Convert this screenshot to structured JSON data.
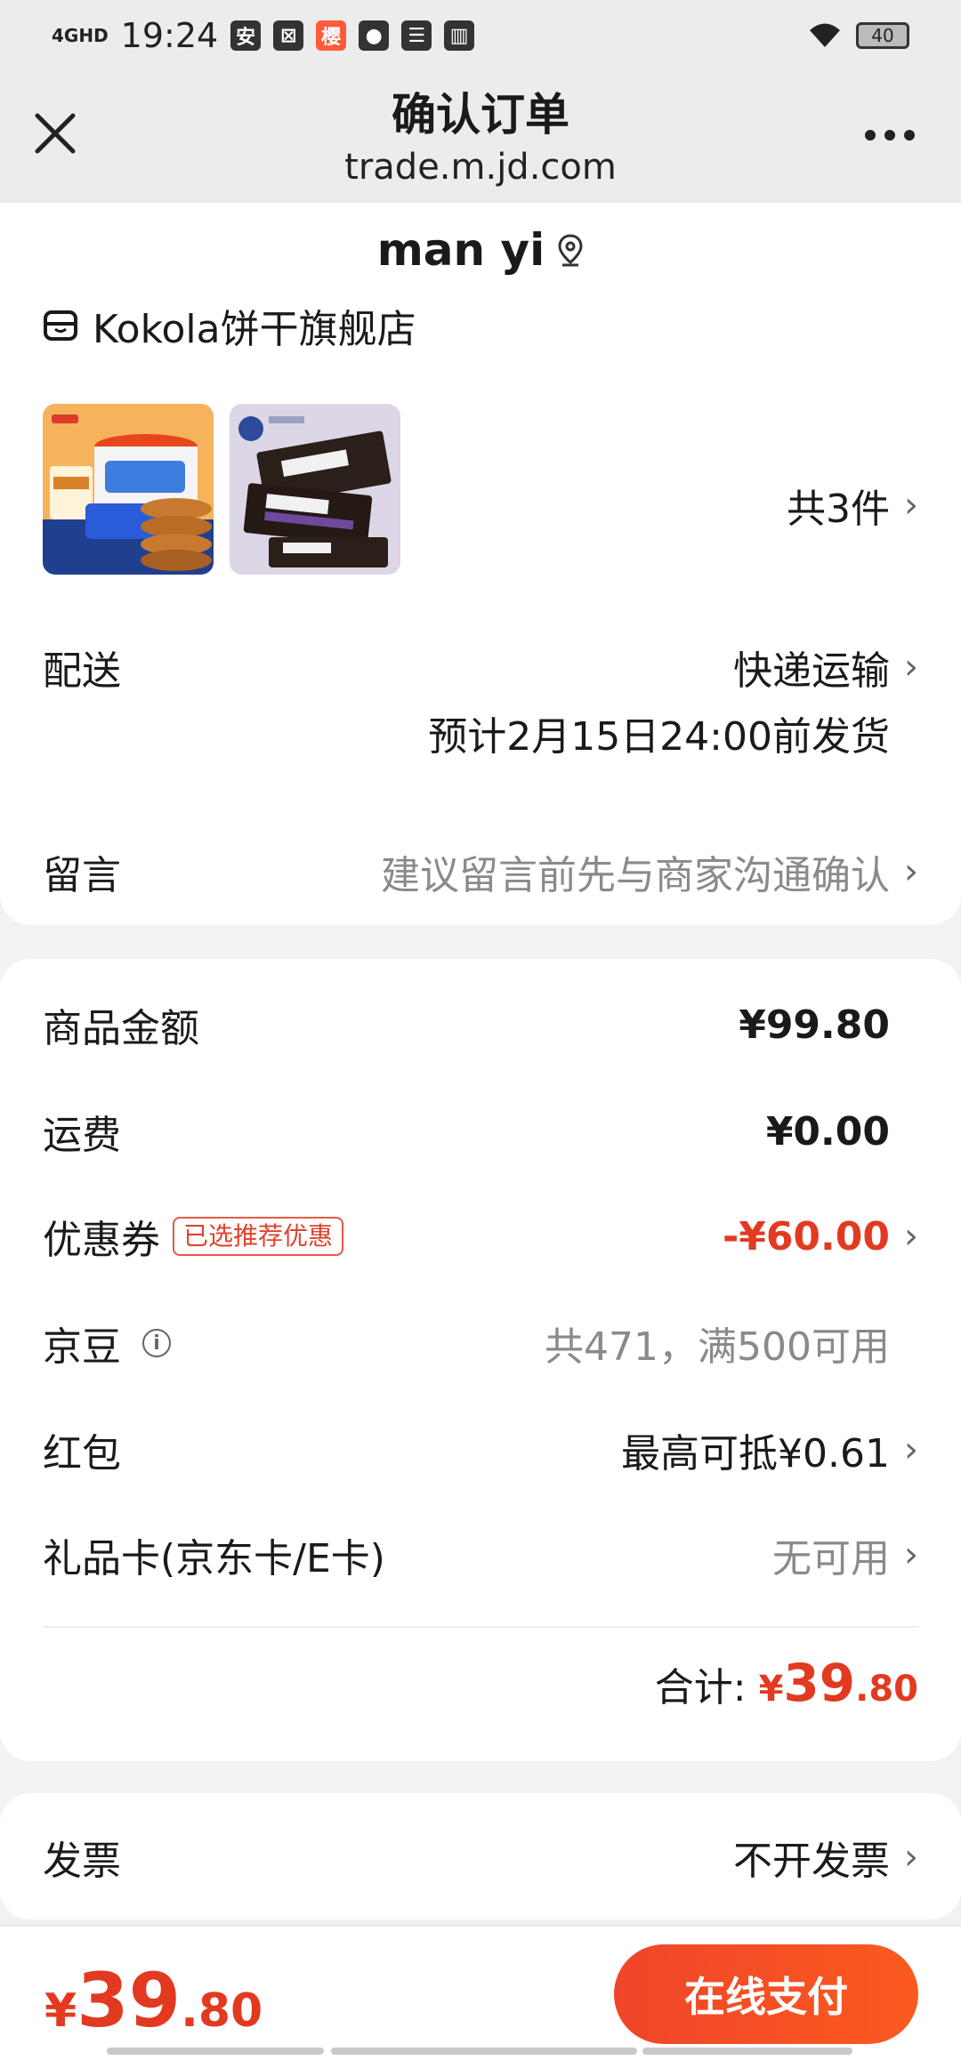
{
  "status_bar": {
    "time": "19:24",
    "network": "4GHD",
    "app_icons": [
      "安",
      "⊠",
      "樱",
      "●",
      "☰",
      "▥"
    ],
    "battery": "40"
  },
  "title_bar": {
    "title": "确认订单",
    "url": "trade.m.jd.com"
  },
  "address": {
    "name": "man yi"
  },
  "store": {
    "name": "Kokola饼干旗舰店",
    "item_count": "共3件"
  },
  "delivery": {
    "label": "配送",
    "method": "快递运输",
    "estimate": "预计2月15日24:00前发货"
  },
  "note": {
    "label": "留言",
    "placeholder": "建议留言前先与商家沟通确认"
  },
  "summary": {
    "goods_label": "商品金额",
    "goods_value": "¥99.80",
    "shipping_label": "运费",
    "shipping_value": "¥0.00",
    "coupon_label": "优惠券",
    "coupon_badge": "已选推荐优惠",
    "coupon_value": "-¥60.00",
    "beans_label": "京豆",
    "beans_value": "共471，满500可用",
    "redpack_label": "红包",
    "redpack_value": "最高可抵¥0.61",
    "giftcard_label": "礼品卡(京东卡/E卡)",
    "giftcard_value": "无可用",
    "total_label": "合计:",
    "total_yen": "¥",
    "total_int": "39",
    "total_dec": ".80"
  },
  "invoice": {
    "label": "发票",
    "value": "不开发票"
  },
  "bottom": {
    "yen": "¥",
    "int": "39",
    "dec": ".80",
    "pay_label": "在线支付"
  },
  "colors": {
    "accent": "#e23a20",
    "pay_button": "#f0452a",
    "background": "#f2f2f2"
  }
}
